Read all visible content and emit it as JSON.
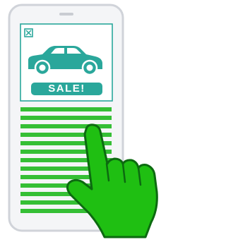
{
  "ad": {
    "icons": {
      "close": "close-box-icon",
      "car": "car-icon",
      "hand": "pointing-hand-icon"
    },
    "sale_label": "SALE!"
  },
  "colors": {
    "phone_body": "#f4f5f7",
    "phone_outline": "#d0d3d9",
    "speaker": "#c9ccd2",
    "ad_border": "#2aa79b",
    "ad_fill": "#2aa79b",
    "content_lines": "#35bf35",
    "hand_fill": "#1fbf12",
    "hand_outline": "#0c6a10"
  }
}
